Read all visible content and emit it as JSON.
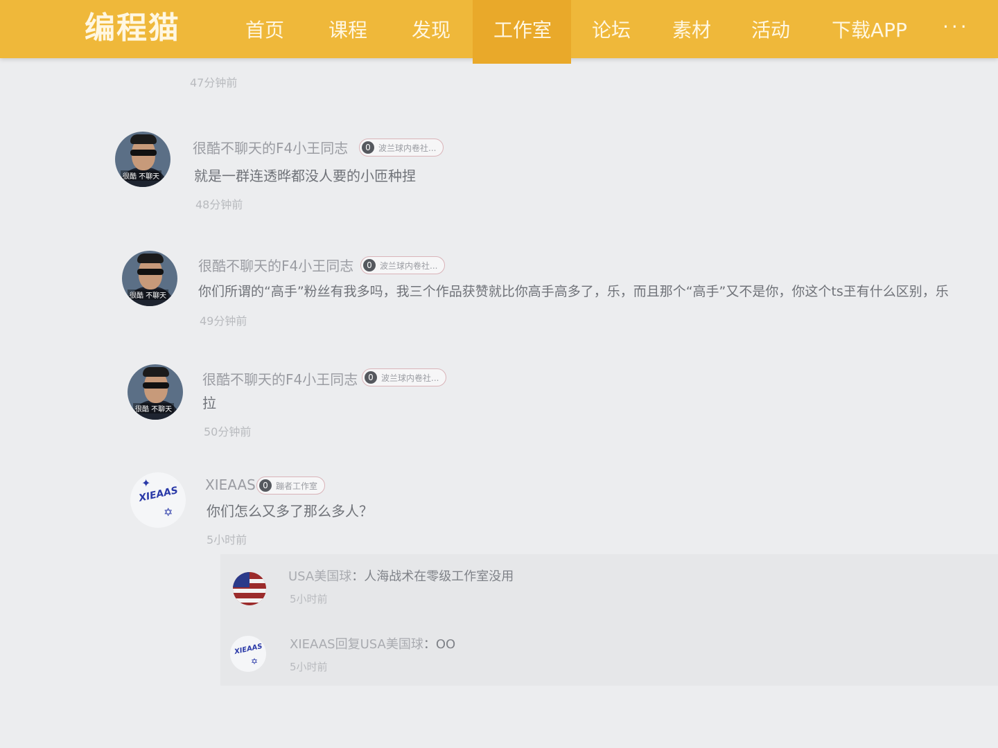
{
  "nav": {
    "logo": "编程猫",
    "items": [
      "首页",
      "课程",
      "发现",
      "工作室",
      "论坛",
      "素材",
      "活动",
      "下载APP",
      "···"
    ],
    "active_index": 3
  },
  "first_partial": {
    "time": "47分钟前"
  },
  "comments": [
    {
      "user": "很酷不聊天的F4小王同志",
      "badge_level": "0",
      "badge_text": "波兰球内卷社...",
      "avatar_tag": "很酷 不聊天",
      "text": "就是一群连透晔都没人要的小匝种捏",
      "time": "48分钟前"
    },
    {
      "user": "很酷不聊天的F4小王同志",
      "badge_level": "0",
      "badge_text": "波兰球内卷社...",
      "avatar_tag": "很酷 不聊天",
      "text": "你们所谓的“高手”粉丝有我多吗，我三个作品获赞就比你高手高多了，乐，而且那个“高手”又不是你，你这个ts玊有什么区别，乐",
      "time": "49分钟前"
    },
    {
      "user": "很酷不聊天的F4小王同志",
      "badge_level": "0",
      "badge_text": "波兰球内卷社...",
      "avatar_tag": "很酷 不聊天",
      "text": "拉",
      "time": "50分钟前"
    },
    {
      "user": "XIEAAS",
      "badge_level": "0",
      "badge_text": "蹦者工作室",
      "avatar_logo": "XIEAAS",
      "text": "你们怎么又多了那么多人？",
      "time": "5小时前"
    }
  ],
  "replies": [
    {
      "from": "USA美国球",
      "sep": "：",
      "text": "人海战术在零级工作室没用",
      "time": "5小时前"
    },
    {
      "from": "XIEAAS回复USA美国球",
      "sep": "：",
      "text": "OO",
      "time": "5小时前",
      "avatar_logo": "XIEAAS"
    }
  ]
}
